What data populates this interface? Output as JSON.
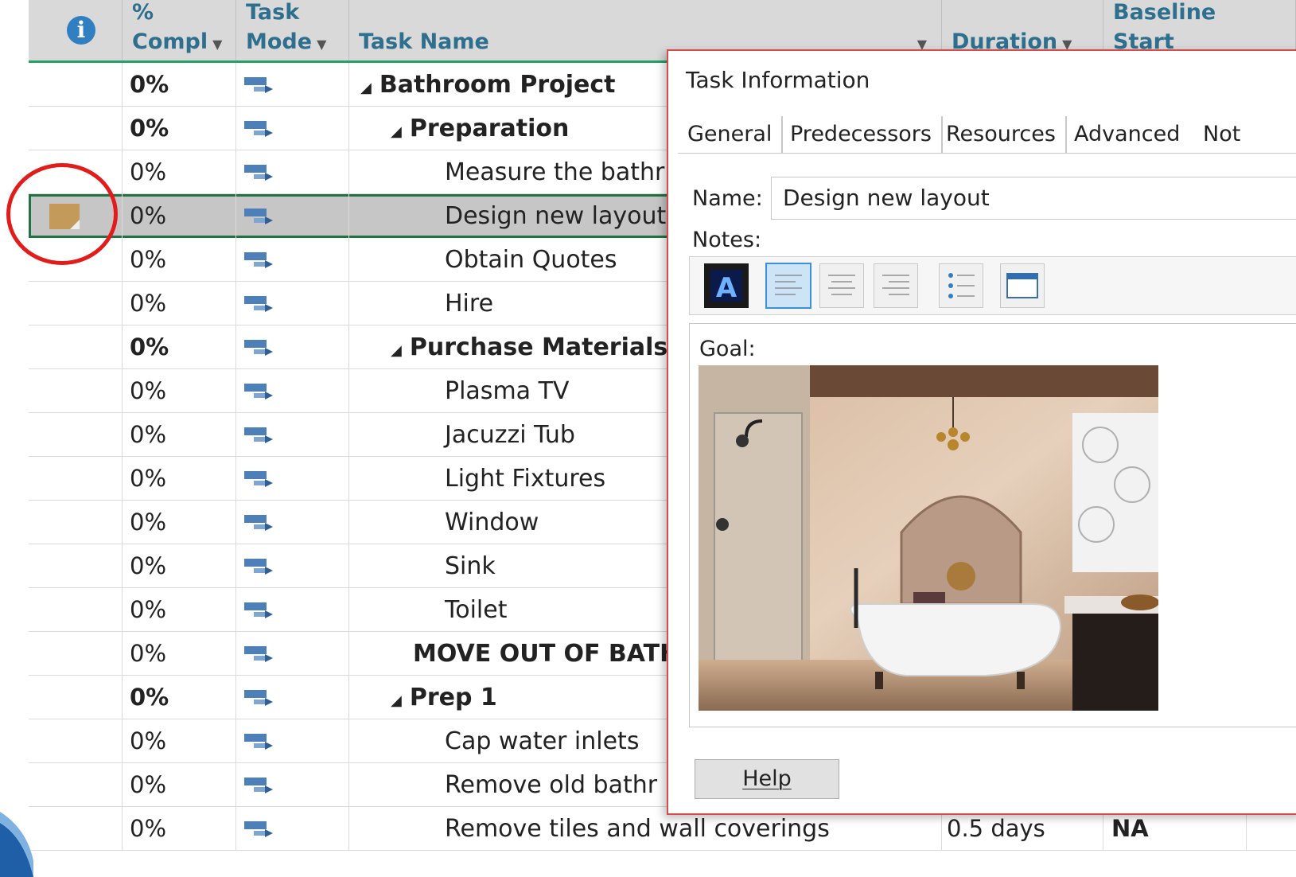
{
  "header": {
    "pct_line1": "%",
    "pct_line2": "Compl",
    "mode_line1": "Task",
    "mode_line2": "Mode",
    "name_label": "Task Name",
    "duration_label": "Duration",
    "baseline_line1": "Baseline",
    "baseline_line2": "Start"
  },
  "tasks": [
    {
      "pct": "0%",
      "name": "Bathroom Project",
      "summary": true,
      "level": 0,
      "duration": "",
      "baseline": ""
    },
    {
      "pct": "0%",
      "name": "Preparation",
      "summary": true,
      "level": 1,
      "duration": "",
      "baseline": ""
    },
    {
      "pct": "0%",
      "name": "Measure the bathr",
      "summary": false,
      "level": 2,
      "duration": "",
      "baseline": ""
    },
    {
      "pct": "0%",
      "name": "Design new layout",
      "summary": false,
      "level": 2,
      "duration": "",
      "baseline": "",
      "selected": true,
      "has_note": true
    },
    {
      "pct": "0%",
      "name": "Obtain Quotes",
      "summary": false,
      "level": 2,
      "duration": "",
      "baseline": ""
    },
    {
      "pct": "0%",
      "name": "Hire",
      "summary": false,
      "level": 2,
      "duration": "",
      "baseline": ""
    },
    {
      "pct": "0%",
      "name": "Purchase Materials",
      "summary": true,
      "level": 1,
      "duration": "",
      "baseline": ""
    },
    {
      "pct": "0%",
      "name": "Plasma TV",
      "summary": false,
      "level": 2,
      "duration": "",
      "baseline": ""
    },
    {
      "pct": "0%",
      "name": "Jacuzzi Tub",
      "summary": false,
      "level": 2,
      "duration": "",
      "baseline": ""
    },
    {
      "pct": "0%",
      "name": "Light Fixtures",
      "summary": false,
      "level": 2,
      "duration": "",
      "baseline": ""
    },
    {
      "pct": "0%",
      "name": "Window",
      "summary": false,
      "level": 2,
      "duration": "",
      "baseline": ""
    },
    {
      "pct": "0%",
      "name": "Sink",
      "summary": false,
      "level": 2,
      "duration": "",
      "baseline": ""
    },
    {
      "pct": "0%",
      "name": "Toilet",
      "summary": false,
      "level": 2,
      "duration": "",
      "baseline": ""
    },
    {
      "pct": "0%",
      "name": "MOVE OUT OF BATHI",
      "summary": false,
      "milestone_bold": true,
      "level": 1,
      "duration": "",
      "baseline": ""
    },
    {
      "pct": "0%",
      "name": "Prep 1",
      "summary": true,
      "level": 1,
      "duration": "",
      "baseline": ""
    },
    {
      "pct": "0%",
      "name": "Cap water inlets",
      "summary": false,
      "level": 2,
      "duration": "",
      "baseline": ""
    },
    {
      "pct": "0%",
      "name": "Remove old bathr",
      "summary": false,
      "level": 2,
      "duration": "",
      "baseline": ""
    },
    {
      "pct": "0%",
      "name": "Remove tiles and wall coverings",
      "summary": false,
      "level": 2,
      "duration": "0.5 days",
      "baseline": "NA"
    }
  ],
  "dialog": {
    "title": "Task Information",
    "tabs": [
      "General",
      "Predecessors",
      "Resources",
      "Advanced",
      "Not"
    ],
    "name_label": "Name:",
    "name_value": "Design new layout",
    "notes_label": "Notes:",
    "notes_text": "Goal:",
    "help_label": "Help"
  },
  "icons": {
    "info": "info-icon",
    "task_mode": "auto-scheduled-task-icon",
    "note": "note-icon"
  },
  "colors": {
    "header_bg": "#d9d9d9",
    "header_text": "#2e6f8e",
    "selection_border": "#217346",
    "highlight_circle": "#e21b1b",
    "dialog_border": "#d94b4b"
  }
}
